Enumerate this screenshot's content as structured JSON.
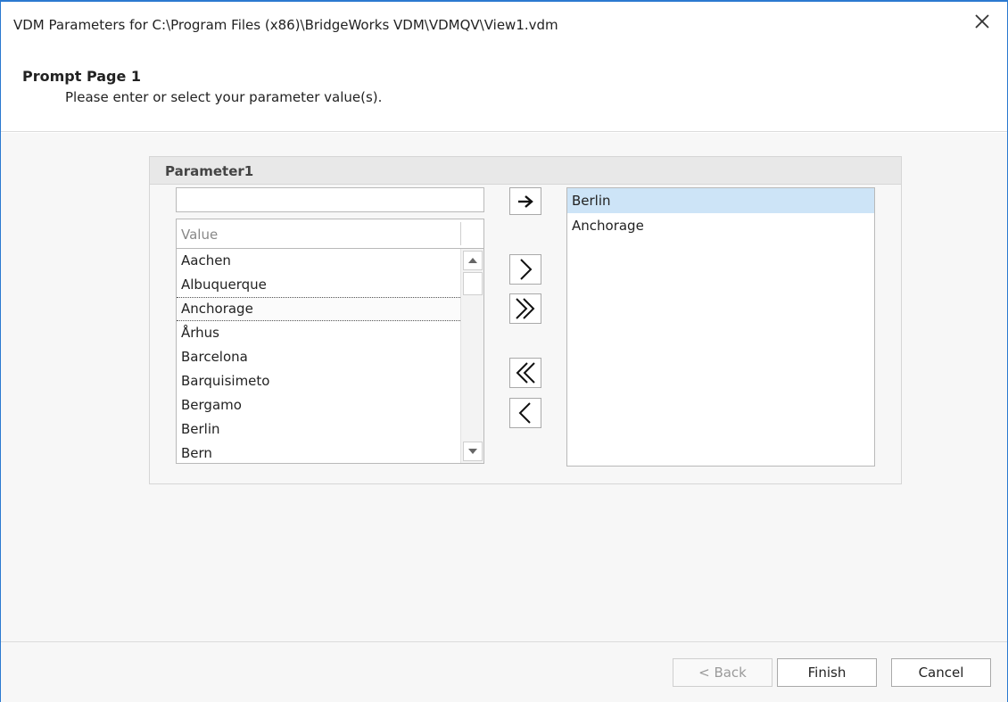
{
  "window": {
    "title": "VDM Parameters for C:\\Program Files (x86)\\BridgeWorks VDM\\VDMQV\\View1.vdm"
  },
  "header": {
    "title": "Prompt Page 1",
    "subtitle": "Please enter or select your parameter value(s)."
  },
  "parameter": {
    "title": "Parameter1",
    "filter_value": "",
    "column_header": "Value",
    "available_values": [
      "Aachen",
      "Albuquerque",
      "Anchorage",
      "Århus",
      "Barcelona",
      "Barquisimeto",
      "Bergamo",
      "Berlin",
      "Bern"
    ],
    "focused_index": 2,
    "selected_values": [
      "Berlin",
      "Anchorage"
    ],
    "selected_highlight_index": 0
  },
  "move_buttons": {
    "add_typed": "arrow-right-icon",
    "add_selected": "chevron-right-icon",
    "add_all": "double-chevron-right-icon",
    "remove_all": "double-chevron-left-icon",
    "remove_selected": "chevron-left-icon"
  },
  "footer": {
    "back_label": "< Back",
    "finish_label": "Finish",
    "cancel_label": "Cancel"
  },
  "colors": {
    "accent_border": "#2b79d0",
    "selection": "#cde4f7"
  }
}
